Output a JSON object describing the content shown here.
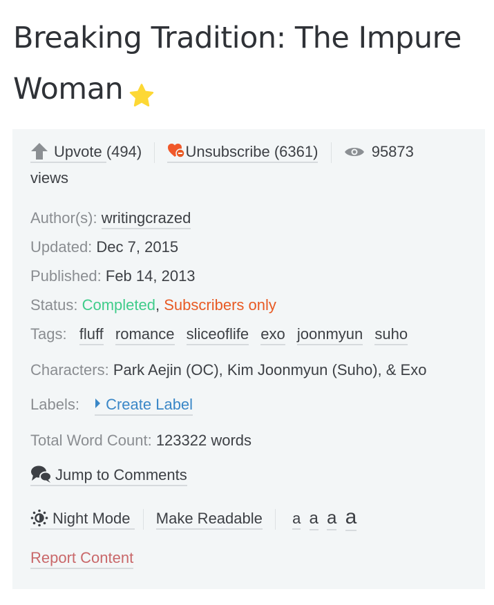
{
  "page": {
    "title": "Breaking Tradition: The Impure Woman",
    "featured_icon": "star-icon"
  },
  "stats": {
    "upvote_label": "Upvote",
    "upvote_count": "(494)",
    "upvote_icon": "arrow-up-icon",
    "unsubscribe_label": "Unsubscribe",
    "subscriber_count": "(6361)",
    "unsubscribe_icon": "heart-minus-icon",
    "views_count": "95873",
    "views_label": "views",
    "views_icon": "eye-icon"
  },
  "meta": {
    "author_label": "Author(s):",
    "author": "writingcrazed",
    "updated_label": "Updated:",
    "updated": "Dec 7, 2015",
    "published_label": "Published:",
    "published": "Feb 14, 2013",
    "status_label": "Status:",
    "status_completed": "Completed",
    "status_separator": ",",
    "status_access": "Subscribers only",
    "tags_label": "Tags:",
    "tags": [
      "fluff",
      "romance",
      "sliceoflife",
      "exo",
      "joonmyun",
      "suho"
    ],
    "characters_label": "Characters:",
    "characters": "Park Aejin (OC), Kim Joonmyun (Suho), & Exo",
    "labels_label": "Labels:",
    "create_label": "Create Label",
    "word_count_label": "Total Word Count:",
    "word_count": "123322 words"
  },
  "actions": {
    "jump_to_comments": "Jump to Comments",
    "night_mode": "Night Mode",
    "make_readable": "Make Readable",
    "font_sizes": [
      "a",
      "a",
      "a",
      "a"
    ],
    "report_content": "Report Content"
  },
  "colors": {
    "completed": "#3fcc8a",
    "subscribers_only": "#e85a24",
    "link_blue": "#3a87c7",
    "report_red": "#c9686a",
    "panel_bg": "#f3f6f7",
    "star": "#fdd835"
  }
}
